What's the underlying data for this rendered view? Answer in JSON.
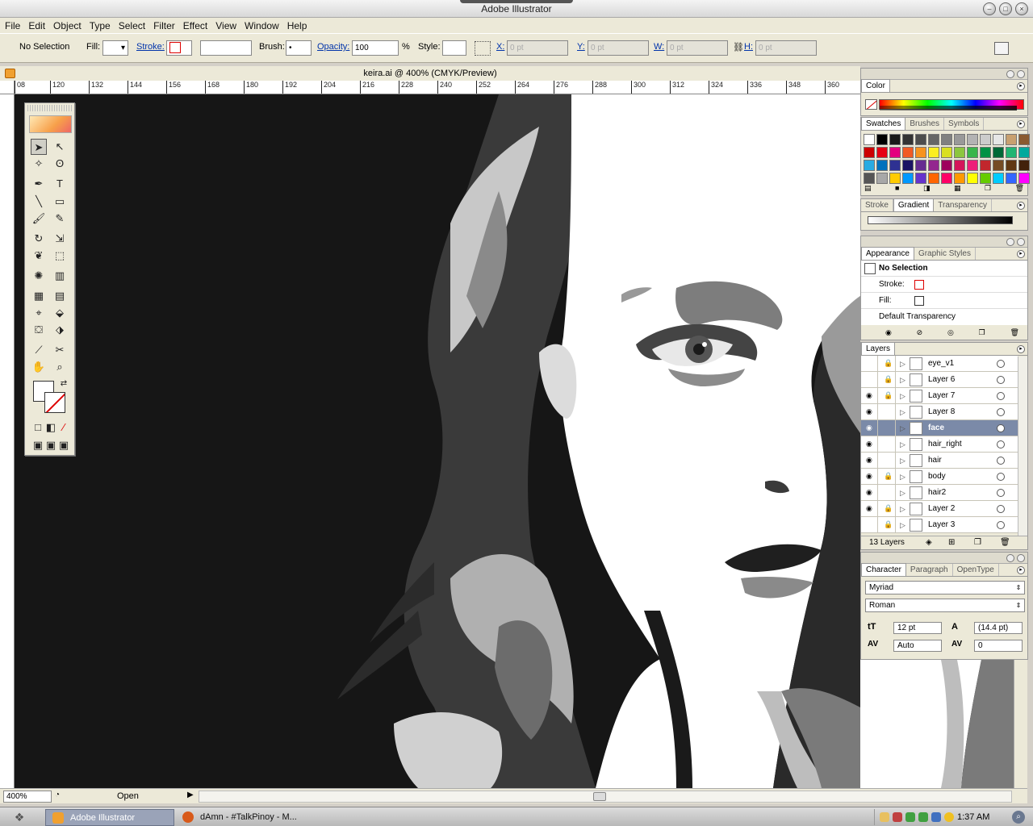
{
  "window": {
    "title": "Adobe Illustrator"
  },
  "menu": [
    "File",
    "Edit",
    "Object",
    "Type",
    "Select",
    "Filter",
    "Effect",
    "View",
    "Window",
    "Help"
  ],
  "control": {
    "selection": "No Selection",
    "fill_label": "Fill:",
    "stroke_label": "Stroke:",
    "brush_label": "Brush:",
    "brush_value": "•",
    "opacity_label": "Opacity:",
    "opacity_value": "100",
    "opacity_unit": "%",
    "style_label": "Style:",
    "x_label": "X:",
    "x_value": "0 pt",
    "y_label": "Y:",
    "y_value": "0 pt",
    "w_label": "W:",
    "w_value": "0 pt",
    "h_label": "H:",
    "h_value": "0 pt"
  },
  "document": {
    "title": "keira.ai @ 400% (CMYK/Preview)",
    "ruler_ticks": [
      "08",
      "120",
      "132",
      "144",
      "156",
      "168",
      "180",
      "192",
      "204",
      "216",
      "228",
      "240",
      "252",
      "264",
      "276",
      "288",
      "300",
      "312",
      "324",
      "336",
      "348",
      "360"
    ]
  },
  "status": {
    "zoom": "400%",
    "status_text": "Open"
  },
  "color_panel": {
    "title": "Color"
  },
  "swatches_panel": {
    "tabs": [
      "Swatches",
      "Brushes",
      "Symbols"
    ],
    "colors": [
      "#ffffff",
      "#000000",
      "#1a1a1a",
      "#333333",
      "#4d4d4d",
      "#666666",
      "#808080",
      "#999999",
      "#b3b3b3",
      "#cccccc",
      "#e6e6e6",
      "#c8a070",
      "#8a5a30",
      "#cc0000",
      "#e60012",
      "#e4007f",
      "#f15a24",
      "#f7931e",
      "#fcee21",
      "#d9e021",
      "#8cc63f",
      "#39b54a",
      "#009245",
      "#006837",
      "#22b573",
      "#00a99d",
      "#29abe2",
      "#0071bc",
      "#2e3192",
      "#1b1464",
      "#662d91",
      "#93278f",
      "#9e005d",
      "#d4145a",
      "#ed1e79",
      "#c1272d",
      "#754c24",
      "#603813",
      "#42210b",
      "#555555",
      "#a8a8a8",
      "#ffcc00",
      "#0099ff",
      "#6633cc",
      "#ff6600",
      "#ff0066",
      "#ff9900",
      "#ffff00",
      "#66cc00",
      "#00ccff",
      "#3366ff",
      "#ff00ff"
    ]
  },
  "gradient_panel": {
    "tabs": [
      "Stroke",
      "Gradient",
      "Transparency"
    ]
  },
  "appearance_panel": {
    "tabs": [
      "Appearance",
      "Graphic Styles"
    ],
    "header": "No Selection",
    "rows": [
      "Stroke:",
      "Fill:",
      "Default Transparency"
    ]
  },
  "layers_panel": {
    "title": "Layers",
    "layers": [
      {
        "name": "eye_v1",
        "visible": false,
        "locked": true
      },
      {
        "name": "Layer 6",
        "visible": false,
        "locked": true
      },
      {
        "name": "Layer 7",
        "visible": true,
        "locked": true
      },
      {
        "name": "Layer 8",
        "visible": true,
        "locked": false
      },
      {
        "name": "face",
        "visible": true,
        "locked": false,
        "selected": true
      },
      {
        "name": "hair_right",
        "visible": true,
        "locked": false
      },
      {
        "name": "hair",
        "visible": true,
        "locked": false
      },
      {
        "name": "body",
        "visible": true,
        "locked": true
      },
      {
        "name": "hair2",
        "visible": true,
        "locked": false
      },
      {
        "name": "Layer 2",
        "visible": true,
        "locked": true
      },
      {
        "name": "Layer 3",
        "visible": false,
        "locked": true
      }
    ],
    "footer": "13 Layers"
  },
  "character_panel": {
    "tabs": [
      "Character",
      "Paragraph",
      "OpenType"
    ],
    "font": "Myriad",
    "style": "Roman",
    "size": "12 pt",
    "leading": "(14.4 pt)",
    "kerning": "Auto",
    "tracking": "0"
  },
  "taskbar": {
    "tasks": [
      "Adobe Illustrator",
      "dAmn - #TalkPinoy - M..."
    ],
    "clock": "1:37 AM"
  }
}
